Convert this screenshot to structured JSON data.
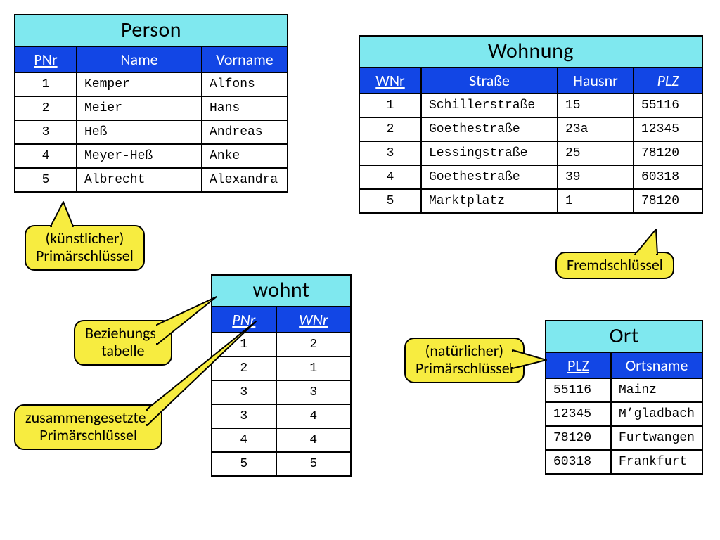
{
  "tables": {
    "person": {
      "title": "Person",
      "cols": [
        "PNr",
        "Name",
        "Vorname"
      ],
      "pk": [
        true,
        false,
        false
      ],
      "fk": [
        false,
        false,
        false
      ],
      "rows": [
        [
          "1",
          "Kemper",
          "Alfons"
        ],
        [
          "2",
          "Meier",
          "Hans"
        ],
        [
          "3",
          "Heß",
          "Andreas"
        ],
        [
          "4",
          "Meyer-Heß",
          "Anke"
        ],
        [
          "5",
          "Albrecht",
          "Alexandra"
        ]
      ]
    },
    "wohnung": {
      "title": "Wohnung",
      "cols": [
        "WNr",
        "Straße",
        "Hausnr",
        "PLZ"
      ],
      "pk": [
        true,
        false,
        false,
        false
      ],
      "fk": [
        false,
        false,
        false,
        true
      ],
      "rows": [
        [
          "1",
          "Schillerstraße",
          "15",
          "55116"
        ],
        [
          "2",
          "Goethestraße",
          "23a",
          "12345"
        ],
        [
          "3",
          "Lessingstraße",
          "25",
          "78120"
        ],
        [
          "4",
          "Goethestraße",
          "39",
          "60318"
        ],
        [
          "5",
          "Marktplatz",
          "1",
          "78120"
        ]
      ]
    },
    "wohnt": {
      "title": "wohnt",
      "cols": [
        "PNr",
        "WNr"
      ],
      "pk": [
        true,
        true
      ],
      "fk": [
        true,
        true
      ],
      "rows": [
        [
          "1",
          "2"
        ],
        [
          "2",
          "1"
        ],
        [
          "3",
          "3"
        ],
        [
          "3",
          "4"
        ],
        [
          "4",
          "4"
        ],
        [
          "5",
          "5"
        ]
      ]
    },
    "ort": {
      "title": "Ort",
      "cols": [
        "PLZ",
        "Ortsname"
      ],
      "pk": [
        true,
        false
      ],
      "fk": [
        false,
        false
      ],
      "rows": [
        [
          "55116",
          "Mainz"
        ],
        [
          "12345",
          "M’gladbach"
        ],
        [
          "78120",
          "Furtwangen"
        ],
        [
          "60318",
          "Frankfurt"
        ]
      ]
    }
  },
  "callouts": {
    "kuenstlich": "(künstlicher)\nPrimärschlüssel",
    "beziehung": "Beziehungs-\ntabelle",
    "zusammen": "zusammengesetzter\nPrimärschlüssel",
    "fremd": "Fremdschlüssel",
    "natuerlich": "(natürlicher)\nPrimärschlüssel"
  }
}
